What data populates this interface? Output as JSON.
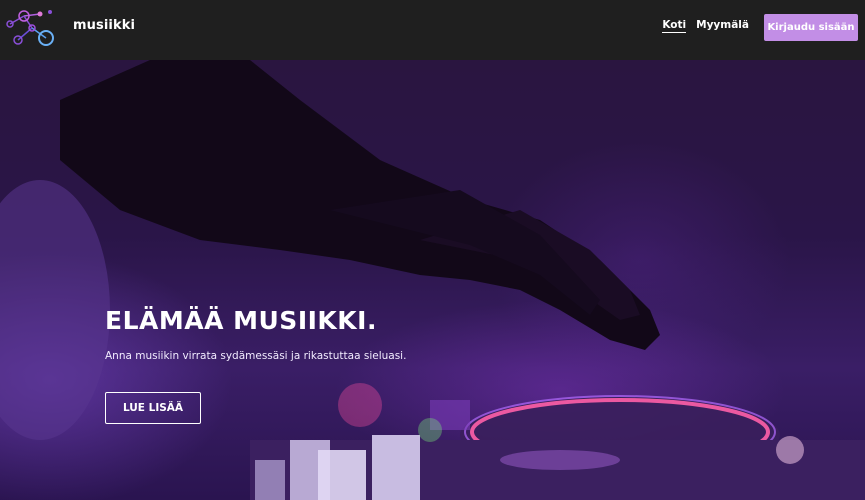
{
  "nav": {
    "brand": "musiikki",
    "links": [
      {
        "label": "Koti",
        "active": true
      },
      {
        "label": "Myymälä",
        "active": false
      }
    ],
    "login_label": "Kirjaudu sisään"
  },
  "hero": {
    "title": "ELÄMÄÄ MUSIIKKI.",
    "subtitle": "Anna musiikin virrata sydämessäsi ja rikastuttaa sieluasi.",
    "button_label": "LUE LISÄÄ"
  },
  "colors": {
    "accent": "#c28ee6",
    "navbar": "#1f1f1f",
    "hero_purple": "#3a1e66"
  }
}
